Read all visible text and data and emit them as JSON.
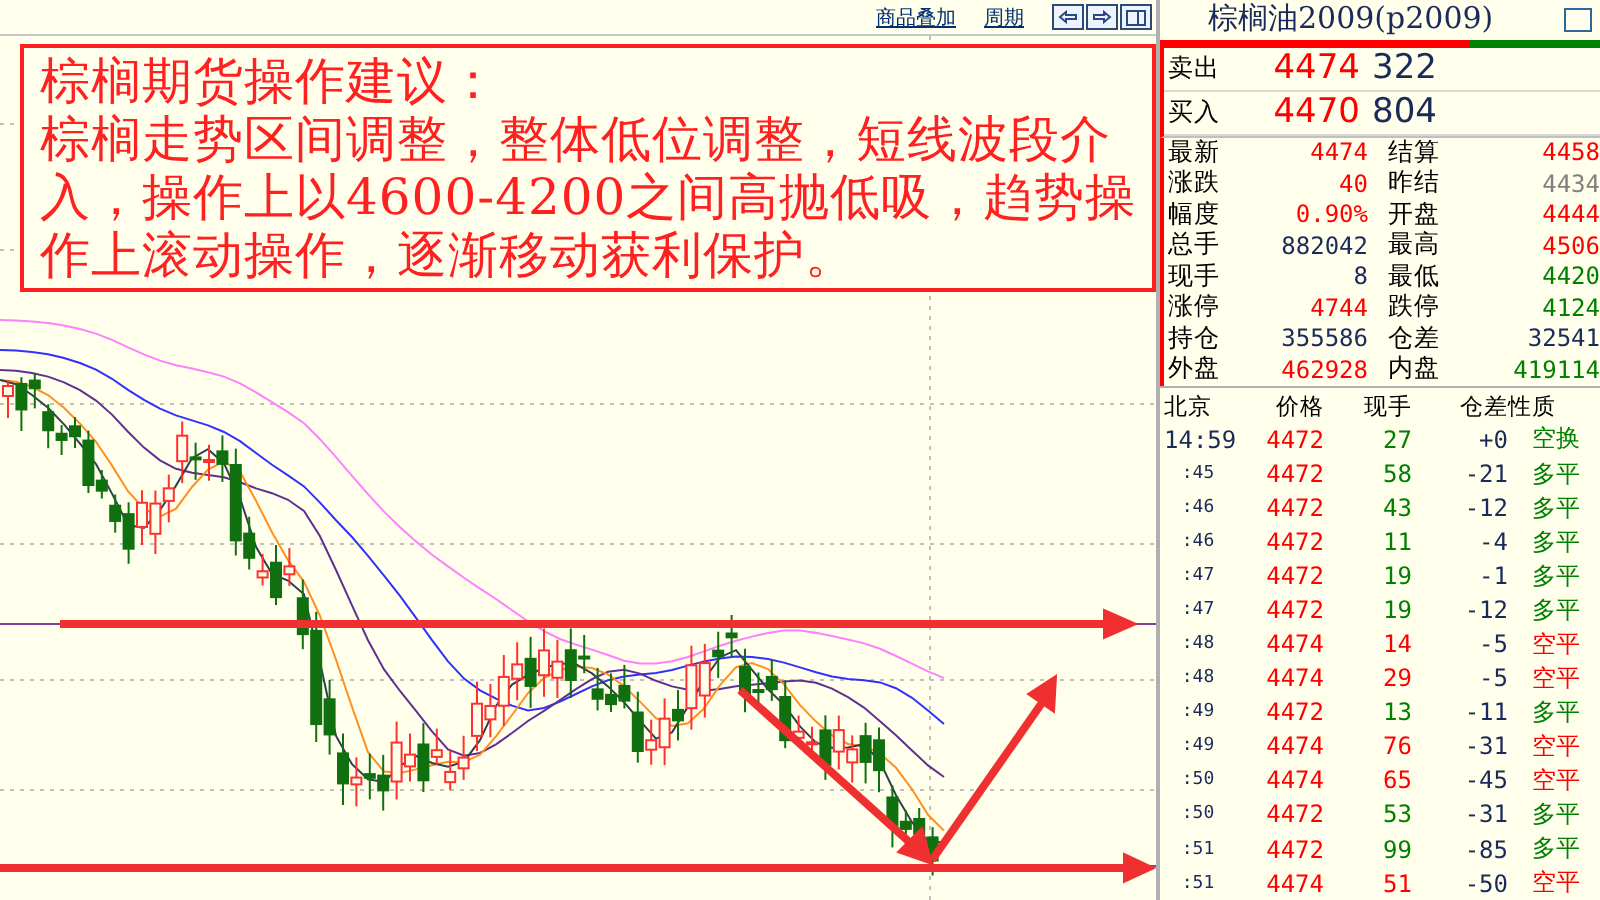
{
  "toolbar": {
    "links": [
      "商品叠加",
      "周期"
    ]
  },
  "annotation": {
    "title": "棕榈期货操作建议：",
    "body": "棕榈走势区间调整，整体低位调整，短线波段介入，操作上以4600-4200之间高抛低吸，趋势操作上滚动操作，逐渐移动获利保护。"
  },
  "quote": {
    "title": "棕榈油2009(p2009)",
    "orders": [
      {
        "label": "卖出",
        "price": "4474",
        "volume": "322"
      },
      {
        "label": "买入",
        "price": "4470",
        "volume": "804"
      }
    ],
    "stats": [
      {
        "label": "最新",
        "value": "4474",
        "color": "#ff0000"
      },
      {
        "label": "结算",
        "value": "4458",
        "color": "#ff0000"
      },
      {
        "label": "涨跌",
        "value": "40",
        "color": "#ff0000"
      },
      {
        "label": "昨结",
        "value": "4434",
        "color": "#808080"
      },
      {
        "label": "幅度",
        "value": "0.90%",
        "color": "#ff0000"
      },
      {
        "label": "开盘",
        "value": "4444",
        "color": "#ff0000"
      },
      {
        "label": "总手",
        "value": "882042",
        "color": "#1a2a5a"
      },
      {
        "label": "最高",
        "value": "4506",
        "color": "#ff0000"
      },
      {
        "label": "现手",
        "value": "8",
        "color": "#1a2a5a"
      },
      {
        "label": "最低",
        "value": "4420",
        "color": "#008000"
      },
      {
        "label": "涨停",
        "value": "4744",
        "color": "#ff0000"
      },
      {
        "label": "跌停",
        "value": "4124",
        "color": "#008000"
      },
      {
        "label": "持仓",
        "value": "355586",
        "color": "#1a2a5a"
      },
      {
        "label": "仓差",
        "value": "32541",
        "color": "#1a2a5a"
      },
      {
        "label": "外盘",
        "value": "462928",
        "color": "#ff0000"
      },
      {
        "label": "内盘",
        "value": "419114",
        "color": "#008000"
      }
    ]
  },
  "ticks": {
    "columns": [
      "北京",
      "价格",
      "现手",
      "仓差",
      "性质"
    ],
    "rows": [
      {
        "time": "14:59",
        "price": "4472",
        "volume": "27",
        "change": "+0",
        "type": "空换",
        "color": "#008000"
      },
      {
        "time": ":45",
        "price": "4472",
        "volume": "58",
        "change": "-21",
        "type": "多平",
        "color": "#008000"
      },
      {
        "time": ":46",
        "price": "4472",
        "volume": "43",
        "change": "-12",
        "type": "多平",
        "color": "#008000"
      },
      {
        "time": ":46",
        "price": "4472",
        "volume": "11",
        "change": "-4",
        "type": "多平",
        "color": "#008000"
      },
      {
        "time": ":47",
        "price": "4472",
        "volume": "19",
        "change": "-1",
        "type": "多平",
        "color": "#008000"
      },
      {
        "time": ":47",
        "price": "4472",
        "volume": "19",
        "change": "-12",
        "type": "多平",
        "color": "#008000"
      },
      {
        "time": ":48",
        "price": "4474",
        "volume": "14",
        "change": "-5",
        "type": "空平",
        "color": "#ff0000"
      },
      {
        "time": ":48",
        "price": "4474",
        "volume": "29",
        "change": "-5",
        "type": "空平",
        "color": "#ff0000"
      },
      {
        "time": ":49",
        "price": "4472",
        "volume": "13",
        "change": "-11",
        "type": "多平",
        "color": "#008000"
      },
      {
        "time": ":49",
        "price": "4474",
        "volume": "76",
        "change": "-31",
        "type": "空平",
        "color": "#ff0000"
      },
      {
        "time": ":50",
        "price": "4474",
        "volume": "65",
        "change": "-45",
        "type": "空平",
        "color": "#ff0000"
      },
      {
        "time": ":50",
        "price": "4472",
        "volume": "53",
        "change": "-31",
        "type": "多平",
        "color": "#008000"
      },
      {
        "time": ":51",
        "price": "4472",
        "volume": "99",
        "change": "-85",
        "type": "多平",
        "color": "#008000"
      },
      {
        "time": ":51",
        "price": "4474",
        "volume": "51",
        "change": "-50",
        "type": "空平",
        "color": "#ff0000"
      }
    ]
  }
}
